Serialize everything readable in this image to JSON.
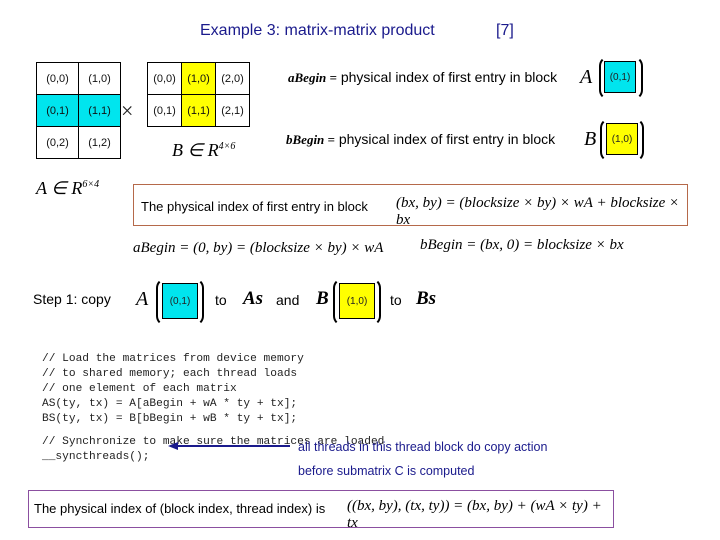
{
  "header": {
    "title": "Example 3: matrix-matrix product",
    "reference": "[7]"
  },
  "matrixA": {
    "rows": [
      [
        "(0,0)",
        "(1,0)"
      ],
      [
        "(0,1)",
        "(1,1)"
      ],
      [
        "(0,2)",
        "(1,2)"
      ]
    ],
    "highlight_row": 1,
    "highlight_color": "#00e5ee",
    "set_label": "A ∈ R",
    "dims": "6×4"
  },
  "operator": "×",
  "matrixB": {
    "rows": [
      [
        "(0,0)",
        "(1,0)",
        "(2,0)"
      ],
      [
        "(0,1)",
        "(1,1)",
        "(2,1)"
      ]
    ],
    "highlight_col": 1,
    "highlight_color": "#ffff00",
    "set_label": "B ∈ R",
    "dims": "4×6"
  },
  "definitions": {
    "aBegin_label": "aBegin =",
    "aBegin_text": "physical index of first entry in block",
    "aBegin_matrix": "A",
    "aBegin_block": "(0,1)",
    "bBegin_label": "bBegin =",
    "bBegin_text": "physical index of first entry in block",
    "bBegin_matrix": "B",
    "bBegin_block": "(1,0)"
  },
  "formula_box": {
    "text": "The physical index of first entry in block",
    "formula": "(bx, by) = (blocksize × by) × wA + blocksize × bx",
    "border_color": "#b5694a"
  },
  "formulas": {
    "aBegin": "aBegin = (0, by) = (blocksize × by) × wA",
    "bBegin": "bBegin = (bx, 0) = blocksize × bx"
  },
  "step1": {
    "label": "Step 1: copy",
    "matrixA": "A",
    "blockA": "(0,1)",
    "to1": "to",
    "targetA": "As",
    "and": "and",
    "matrixB": "B",
    "blockB": "(1,0)",
    "to2": "to",
    "targetB": "Bs"
  },
  "code": {
    "lines": [
      "// Load the matrices from device memory",
      "// to shared memory; each thread loads",
      "// one element of each matrix",
      "AS(ty, tx) = A[aBegin + wA * ty + tx];",
      "BS(ty, tx) = B[bBegin + wB * ty + tx];",
      "",
      "// Synchronize to make sure the matrices are loaded",
      "__syncthreads();"
    ]
  },
  "annotation": {
    "line1": "all threads in this thread block do copy action",
    "line2": "before submatrix C is computed",
    "color": "#1a1a8c"
  },
  "bottom_box": {
    "text": "The physical index of (block index, thread index) is",
    "formula": "((bx, by), (tx, ty)) = (bx, by) + (wA × ty) + tx",
    "border_color": "#8b4fa0"
  }
}
